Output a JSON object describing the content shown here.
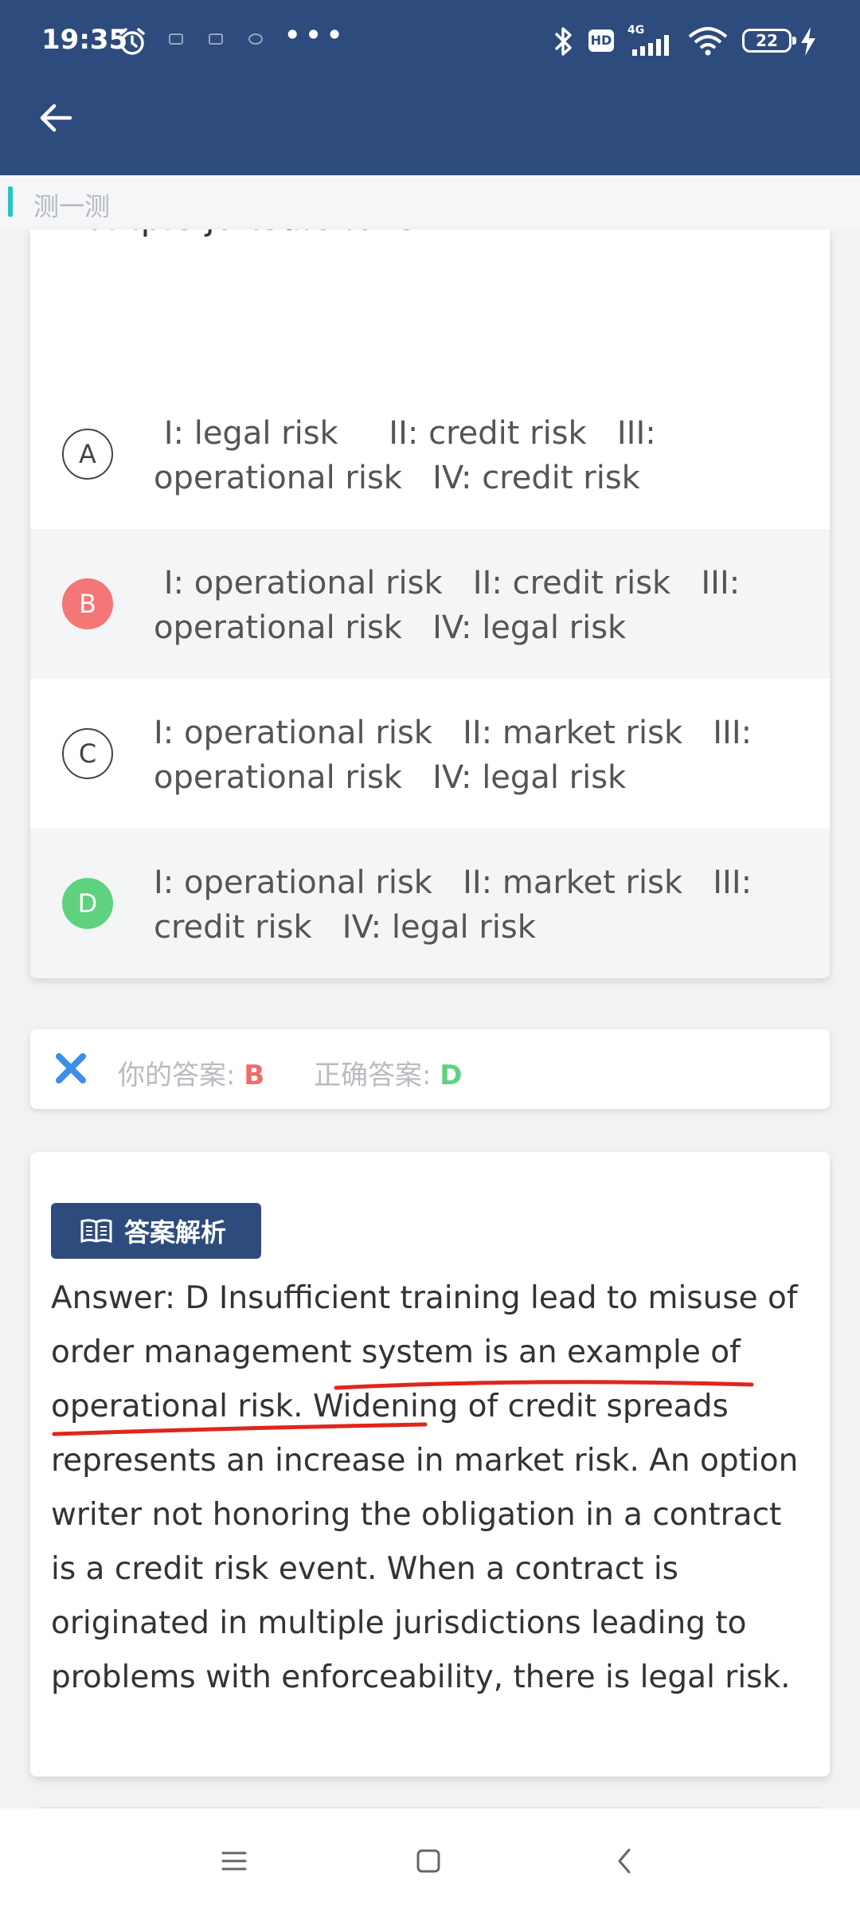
{
  "status_bar": {
    "time": "19:35",
    "network": "4G",
    "hd": "HD",
    "battery": "22"
  },
  "header": {
    "back_icon": "arrow-left-icon"
  },
  "section": {
    "title": "测一测"
  },
  "question": {
    "text_fragment": "multiple jurisdictions.",
    "options": [
      {
        "letter": "A",
        "text": " I: legal risk     II: credit risk   III: operational risk   IV: credit risk",
        "state": "normal"
      },
      {
        "letter": "B",
        "text": " I: operational risk   II: credit risk   III: operational risk   IV: legal risk",
        "state": "wrong"
      },
      {
        "letter": "C",
        "text": "I: operational risk   II: market risk   III: operational risk   IV: legal risk",
        "state": "normal"
      },
      {
        "letter": "D",
        "text": "I: operational risk   II: market risk   III: credit risk   IV: legal risk",
        "state": "correct"
      }
    ]
  },
  "result": {
    "your_answer_label": "你的答案:",
    "your_answer_value": "B",
    "correct_answer_label": "正确答案:",
    "correct_answer_value": "D"
  },
  "analysis": {
    "button_label": "答案解析",
    "text": "Answer: D Insufficient training lead to misuse of order management system is an example of operational risk. Widening of credit spreads represents an increase in market risk. An option writer not honoring the obligation in a contract is a credit risk event. When a contract is originated in multiple jurisdictions leading to problems with enforceability, there is legal risk."
  },
  "colors": {
    "header_bg": "#2d4b7c",
    "wrong": "#f47676",
    "correct": "#5fd27f",
    "accent": "#2bc2c7",
    "underline": "#e0261c"
  }
}
